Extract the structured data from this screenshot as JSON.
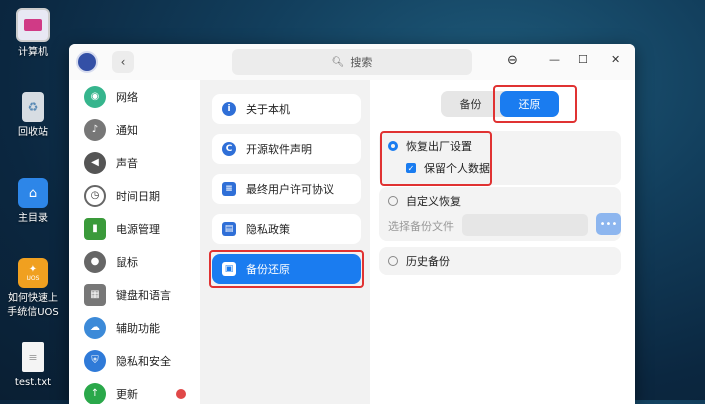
{
  "desktop": {
    "icons": [
      {
        "label": "计算机"
      },
      {
        "label": "回收站"
      },
      {
        "label": "主目录"
      },
      {
        "label_lines": [
          "如何快速上",
          "手统信UOS"
        ],
        "badge": "UOS"
      },
      {
        "label": "test.txt"
      }
    ]
  },
  "titlebar": {
    "search_label": "搜索",
    "menu_icon": "⊖",
    "min_icon": "—",
    "max_icon": "☐",
    "close_icon": "✕"
  },
  "sidebar": {
    "items": [
      {
        "label": "网络",
        "color": "#36b58d"
      },
      {
        "label": "通知",
        "color": "#777777"
      },
      {
        "label": "声音",
        "color": "#555555"
      },
      {
        "label": "时间日期",
        "color": "#888888"
      },
      {
        "label": "电源管理",
        "color": "#3a9a3a"
      },
      {
        "label": "鼠标",
        "color": "#666666"
      },
      {
        "label": "键盘和语言",
        "color": "#777777"
      },
      {
        "label": "辅助功能",
        "color": "#3c8ad8"
      },
      {
        "label": "隐私和安全",
        "color": "#2f7ad8"
      },
      {
        "label": "更新",
        "color": "#2aa84a"
      }
    ]
  },
  "middle": {
    "items": [
      {
        "label": "关于本机",
        "icon": "i"
      },
      {
        "label": "开源软件声明",
        "icon": "C"
      },
      {
        "label": "最终用户许可协议",
        "icon": "≡"
      },
      {
        "label": "隐私政策",
        "icon": "▤"
      },
      {
        "label": "备份还原",
        "icon": "▣"
      }
    ]
  },
  "panel": {
    "tabs": [
      "备份",
      "还原"
    ],
    "factory_reset": "恢复出厂设置",
    "keep_personal": "保留个人数据",
    "custom_restore": "自定义恢复",
    "file_placeholder": "选择备份文件",
    "more": "•••",
    "history_backup": "历史备份"
  },
  "colors": {
    "accent": "#1a7cf0",
    "highlight_box": "#e03232"
  }
}
